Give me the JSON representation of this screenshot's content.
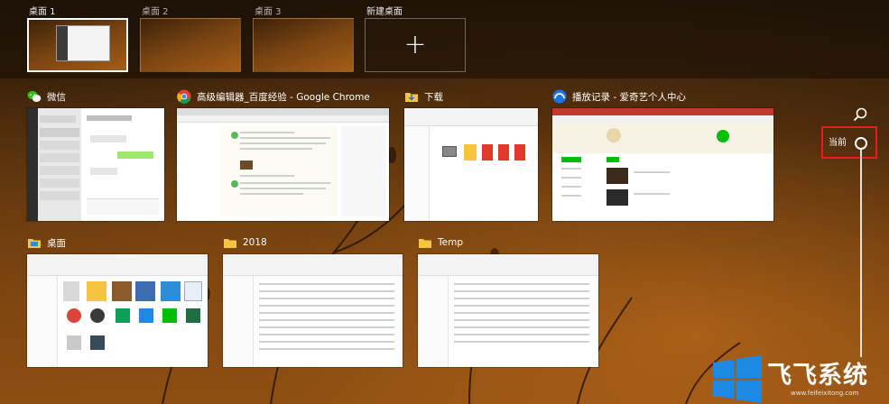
{
  "desktops": [
    {
      "label": "桌面 1",
      "active": true
    },
    {
      "label": "桌面 2",
      "active": false
    },
    {
      "label": "桌面 3",
      "active": false
    }
  ],
  "new_desktop": {
    "label": "新建桌面",
    "icon": "plus-icon"
  },
  "windows": [
    {
      "title": "微信",
      "icon": "wechat-icon"
    },
    {
      "title": "高级编辑器_百度经验 - Google Chrome",
      "icon": "chrome-icon"
    },
    {
      "title": "下载",
      "icon": "folder-download-icon"
    },
    {
      "title": "播放记录 - 爱奇艺个人中心",
      "icon": "iqiyi-icon"
    },
    {
      "title": "桌面",
      "icon": "folder-desktop-icon"
    },
    {
      "title": "2018",
      "icon": "folder-icon"
    },
    {
      "title": "Temp",
      "icon": "folder-icon"
    }
  ],
  "timeline": {
    "current_label": "当前",
    "search_icon": "search-icon"
  },
  "watermark": {
    "text": "飞飞系统",
    "url": "www.feifeixitong.com"
  },
  "colors": {
    "highlight": "#e02020",
    "wechat": "#2dc100",
    "chrome_red": "#db4437",
    "iqiyi": "#00be06"
  }
}
